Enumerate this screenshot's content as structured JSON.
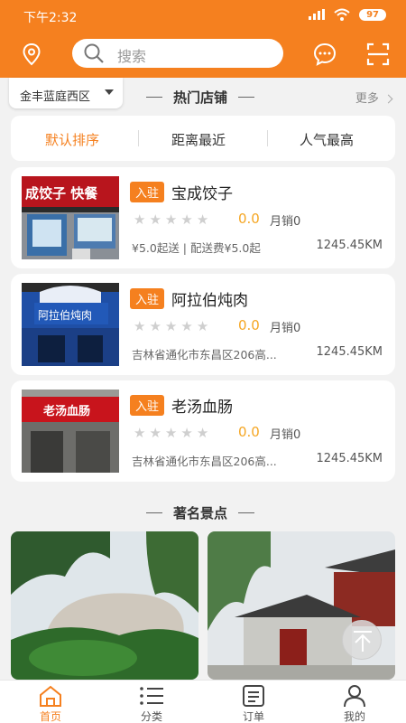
{
  "status": {
    "time": "下午2:32",
    "battery": "97"
  },
  "header": {
    "search_placeholder": "搜索"
  },
  "district": "金丰蓝庭西区",
  "hot_shops": {
    "title": "热门店铺",
    "more": "更多"
  },
  "sort": [
    "默认排序",
    "距离最近",
    "人气最高"
  ],
  "shops": [
    {
      "badge": "入驻",
      "name": "宝成饺子",
      "rating": "0.0",
      "sales": "月销0",
      "info": "¥5.0起送 | 配送费¥5.0起",
      "distance": "1245.45KM",
      "sign": "成饺子 快餐"
    },
    {
      "badge": "入驻",
      "name": "阿拉伯炖肉",
      "rating": "0.0",
      "sales": "月销0",
      "info": "吉林省通化市东昌区206高...",
      "distance": "1245.45KM",
      "sign": "阿拉伯炖肉"
    },
    {
      "badge": "入驻",
      "name": "老汤血肠",
      "rating": "0.0",
      "sales": "月销0",
      "info": "吉林省通化市东昌区206高...",
      "distance": "1245.45KM",
      "sign": "老汤血肠"
    }
  ],
  "scenic": {
    "title": "著名景点"
  },
  "tabs": [
    {
      "label": "首页",
      "icon": "home-icon"
    },
    {
      "label": "分类",
      "icon": "list-icon"
    },
    {
      "label": "订单",
      "icon": "order-icon"
    },
    {
      "label": "我的",
      "icon": "user-icon"
    }
  ],
  "colors": {
    "accent": "#f5801f",
    "rating": "#f5a623"
  }
}
